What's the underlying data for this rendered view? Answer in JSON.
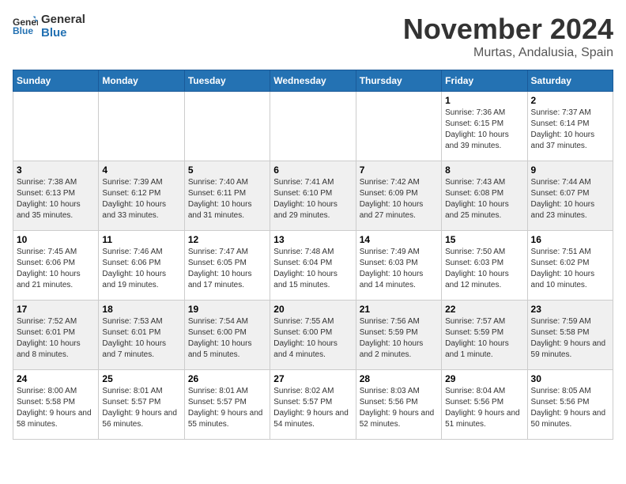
{
  "header": {
    "logo_line1": "General",
    "logo_line2": "Blue",
    "month": "November 2024",
    "location": "Murtas, Andalusia, Spain"
  },
  "weekdays": [
    "Sunday",
    "Monday",
    "Tuesday",
    "Wednesday",
    "Thursday",
    "Friday",
    "Saturday"
  ],
  "weeks": [
    [
      {
        "day": "",
        "sunrise": "",
        "sunset": "",
        "daylight": ""
      },
      {
        "day": "",
        "sunrise": "",
        "sunset": "",
        "daylight": ""
      },
      {
        "day": "",
        "sunrise": "",
        "sunset": "",
        "daylight": ""
      },
      {
        "day": "",
        "sunrise": "",
        "sunset": "",
        "daylight": ""
      },
      {
        "day": "",
        "sunrise": "",
        "sunset": "",
        "daylight": ""
      },
      {
        "day": "1",
        "sunrise": "Sunrise: 7:36 AM",
        "sunset": "Sunset: 6:15 PM",
        "daylight": "Daylight: 10 hours and 39 minutes."
      },
      {
        "day": "2",
        "sunrise": "Sunrise: 7:37 AM",
        "sunset": "Sunset: 6:14 PM",
        "daylight": "Daylight: 10 hours and 37 minutes."
      }
    ],
    [
      {
        "day": "3",
        "sunrise": "Sunrise: 7:38 AM",
        "sunset": "Sunset: 6:13 PM",
        "daylight": "Daylight: 10 hours and 35 minutes."
      },
      {
        "day": "4",
        "sunrise": "Sunrise: 7:39 AM",
        "sunset": "Sunset: 6:12 PM",
        "daylight": "Daylight: 10 hours and 33 minutes."
      },
      {
        "day": "5",
        "sunrise": "Sunrise: 7:40 AM",
        "sunset": "Sunset: 6:11 PM",
        "daylight": "Daylight: 10 hours and 31 minutes."
      },
      {
        "day": "6",
        "sunrise": "Sunrise: 7:41 AM",
        "sunset": "Sunset: 6:10 PM",
        "daylight": "Daylight: 10 hours and 29 minutes."
      },
      {
        "day": "7",
        "sunrise": "Sunrise: 7:42 AM",
        "sunset": "Sunset: 6:09 PM",
        "daylight": "Daylight: 10 hours and 27 minutes."
      },
      {
        "day": "8",
        "sunrise": "Sunrise: 7:43 AM",
        "sunset": "Sunset: 6:08 PM",
        "daylight": "Daylight: 10 hours and 25 minutes."
      },
      {
        "day": "9",
        "sunrise": "Sunrise: 7:44 AM",
        "sunset": "Sunset: 6:07 PM",
        "daylight": "Daylight: 10 hours and 23 minutes."
      }
    ],
    [
      {
        "day": "10",
        "sunrise": "Sunrise: 7:45 AM",
        "sunset": "Sunset: 6:06 PM",
        "daylight": "Daylight: 10 hours and 21 minutes."
      },
      {
        "day": "11",
        "sunrise": "Sunrise: 7:46 AM",
        "sunset": "Sunset: 6:06 PM",
        "daylight": "Daylight: 10 hours and 19 minutes."
      },
      {
        "day": "12",
        "sunrise": "Sunrise: 7:47 AM",
        "sunset": "Sunset: 6:05 PM",
        "daylight": "Daylight: 10 hours and 17 minutes."
      },
      {
        "day": "13",
        "sunrise": "Sunrise: 7:48 AM",
        "sunset": "Sunset: 6:04 PM",
        "daylight": "Daylight: 10 hours and 15 minutes."
      },
      {
        "day": "14",
        "sunrise": "Sunrise: 7:49 AM",
        "sunset": "Sunset: 6:03 PM",
        "daylight": "Daylight: 10 hours and 14 minutes."
      },
      {
        "day": "15",
        "sunrise": "Sunrise: 7:50 AM",
        "sunset": "Sunset: 6:03 PM",
        "daylight": "Daylight: 10 hours and 12 minutes."
      },
      {
        "day": "16",
        "sunrise": "Sunrise: 7:51 AM",
        "sunset": "Sunset: 6:02 PM",
        "daylight": "Daylight: 10 hours and 10 minutes."
      }
    ],
    [
      {
        "day": "17",
        "sunrise": "Sunrise: 7:52 AM",
        "sunset": "Sunset: 6:01 PM",
        "daylight": "Daylight: 10 hours and 8 minutes."
      },
      {
        "day": "18",
        "sunrise": "Sunrise: 7:53 AM",
        "sunset": "Sunset: 6:01 PM",
        "daylight": "Daylight: 10 hours and 7 minutes."
      },
      {
        "day": "19",
        "sunrise": "Sunrise: 7:54 AM",
        "sunset": "Sunset: 6:00 PM",
        "daylight": "Daylight: 10 hours and 5 minutes."
      },
      {
        "day": "20",
        "sunrise": "Sunrise: 7:55 AM",
        "sunset": "Sunset: 6:00 PM",
        "daylight": "Daylight: 10 hours and 4 minutes."
      },
      {
        "day": "21",
        "sunrise": "Sunrise: 7:56 AM",
        "sunset": "Sunset: 5:59 PM",
        "daylight": "Daylight: 10 hours and 2 minutes."
      },
      {
        "day": "22",
        "sunrise": "Sunrise: 7:57 AM",
        "sunset": "Sunset: 5:59 PM",
        "daylight": "Daylight: 10 hours and 1 minute."
      },
      {
        "day": "23",
        "sunrise": "Sunrise: 7:59 AM",
        "sunset": "Sunset: 5:58 PM",
        "daylight": "Daylight: 9 hours and 59 minutes."
      }
    ],
    [
      {
        "day": "24",
        "sunrise": "Sunrise: 8:00 AM",
        "sunset": "Sunset: 5:58 PM",
        "daylight": "Daylight: 9 hours and 58 minutes."
      },
      {
        "day": "25",
        "sunrise": "Sunrise: 8:01 AM",
        "sunset": "Sunset: 5:57 PM",
        "daylight": "Daylight: 9 hours and 56 minutes."
      },
      {
        "day": "26",
        "sunrise": "Sunrise: 8:01 AM",
        "sunset": "Sunset: 5:57 PM",
        "daylight": "Daylight: 9 hours and 55 minutes."
      },
      {
        "day": "27",
        "sunrise": "Sunrise: 8:02 AM",
        "sunset": "Sunset: 5:57 PM",
        "daylight": "Daylight: 9 hours and 54 minutes."
      },
      {
        "day": "28",
        "sunrise": "Sunrise: 8:03 AM",
        "sunset": "Sunset: 5:56 PM",
        "daylight": "Daylight: 9 hours and 52 minutes."
      },
      {
        "day": "29",
        "sunrise": "Sunrise: 8:04 AM",
        "sunset": "Sunset: 5:56 PM",
        "daylight": "Daylight: 9 hours and 51 minutes."
      },
      {
        "day": "30",
        "sunrise": "Sunrise: 8:05 AM",
        "sunset": "Sunset: 5:56 PM",
        "daylight": "Daylight: 9 hours and 50 minutes."
      }
    ]
  ]
}
